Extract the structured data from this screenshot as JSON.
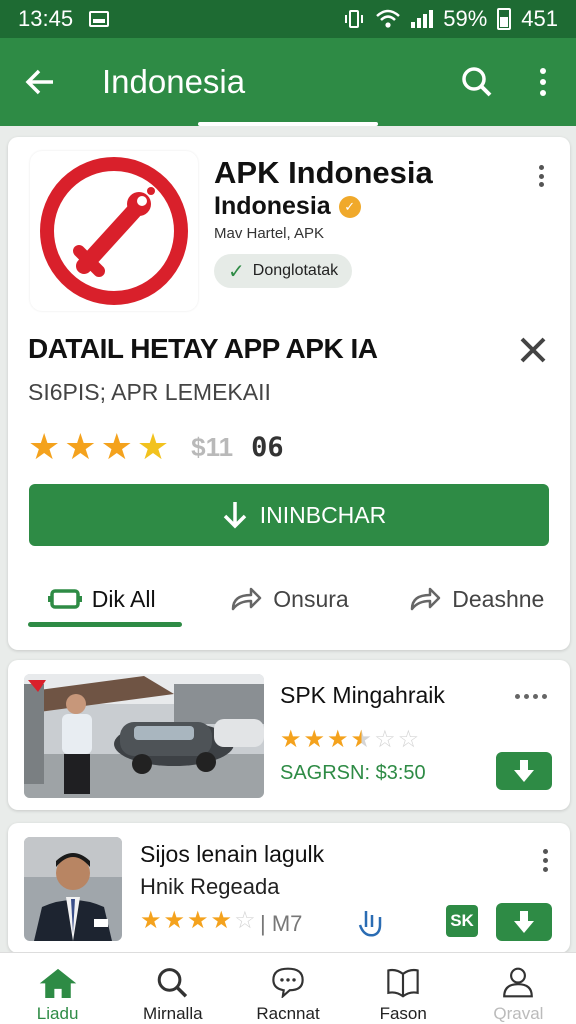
{
  "status": {
    "time": "13:45",
    "battery": "59%",
    "extra": "451"
  },
  "appbar": {
    "title": "Indonesia",
    "back_icon": "arrow-left-icon",
    "search_icon": "search-icon",
    "menu_icon": "more-vert-icon"
  },
  "app": {
    "name": "APK Indonesia",
    "subtitle": "Indonesia",
    "developer": "Mav Hartel, APK",
    "chip": "Donglotatak",
    "detail_title": "DATAIL HETAY APP APK IA",
    "detail_sub": "SI6PIS; APR LEMEKAII",
    "rating": 4,
    "price_old": "$11",
    "price": "06",
    "install_label": "ININBCHAR",
    "colors": {
      "accent": "#2e8b45",
      "logo_red": "#d9202b",
      "star": "#f4a21d"
    }
  },
  "tabs": [
    {
      "label": "Dik All",
      "icon": "battery-icon",
      "active": true
    },
    {
      "label": "Onsura",
      "icon": "share-icon",
      "active": false
    },
    {
      "label": "Deashne",
      "icon": "share-icon",
      "active": false
    }
  ],
  "items": [
    {
      "title": "SPK Mingahraik",
      "rating": 3.5,
      "price": "SAGRSN: $3:50"
    },
    {
      "title": "Sijos lenain lagulk",
      "subtitle": "Hnik Regeada",
      "rating": 4,
      "meta": "M7",
      "badge": "SK"
    }
  ],
  "bottom_nav": [
    {
      "label": "Liadu",
      "icon": "home-icon",
      "state": "active"
    },
    {
      "label": "Mirnalla",
      "icon": "search-icon",
      "state": "normal"
    },
    {
      "label": "Racnnat",
      "icon": "chat-icon",
      "state": "normal"
    },
    {
      "label": "Fason",
      "icon": "book-icon",
      "state": "normal"
    },
    {
      "label": "Qraval",
      "icon": "person-icon",
      "state": "disabled"
    }
  ]
}
